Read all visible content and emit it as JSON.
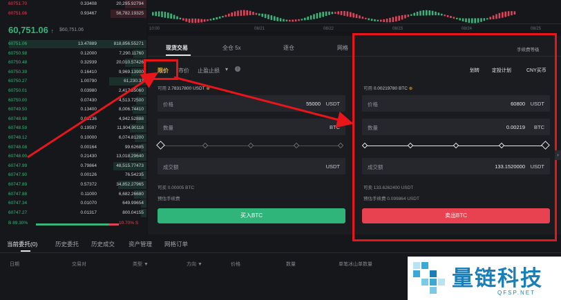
{
  "orderbook": {
    "asks": [
      {
        "price": "60751.70",
        "amount": "0.33408",
        "total": "20,295.92794"
      },
      {
        "price": "60751.06",
        "amount": "0.93467",
        "total": "56,782.19325"
      }
    ],
    "last_price": "60,751.06",
    "last_price_arrow": "↑",
    "last_price_sub": "$60,751.06",
    "bids": [
      {
        "price": "60751.06",
        "amount": "13.47889",
        "total": "818,856.55271"
      },
      {
        "price": "60750.98",
        "amount": "0.12000",
        "total": "7,290.11760"
      },
      {
        "price": "60750.48",
        "amount": "0.32939",
        "total": "20,010.57426"
      },
      {
        "price": "60750.39",
        "amount": "0.16410",
        "total": "9,969.13900"
      },
      {
        "price": "60750.27",
        "amount": "1.00790",
        "total": "61,230.33"
      },
      {
        "price": "60750.01",
        "amount": "0.03980",
        "total": "2,417.85060"
      },
      {
        "price": "60750.00",
        "amount": "0.07430",
        "total": "4,513.72500"
      },
      {
        "price": "60749.50",
        "amount": "0.13400",
        "total": "8,006.74410"
      },
      {
        "price": "60748.98",
        "amount": "0.08136",
        "total": "4,942.52888"
      },
      {
        "price": "60748.59",
        "amount": "0.19597",
        "total": "11,904.90118"
      },
      {
        "price": "60748.12",
        "amount": "0.10000",
        "total": "6,074.81200"
      },
      {
        "price": "60748.08",
        "amount": "0.00164",
        "total": "99.62685"
      },
      {
        "price": "60748.00",
        "amount": "0.21430",
        "total": "13,018.29640"
      },
      {
        "price": "60747.99",
        "amount": "0.79864",
        "total": "48,515.77473"
      },
      {
        "price": "60747.90",
        "amount": "0.00126",
        "total": "76.54235"
      },
      {
        "price": "60747.89",
        "amount": "0.57372",
        "total": "34,852.27965"
      },
      {
        "price": "60747.88",
        "amount": "0.11000",
        "total": "6,682.26680"
      },
      {
        "price": "60747.34",
        "amount": "0.01070",
        "total": "649.99654"
      },
      {
        "price": "60747.27",
        "amount": "0.01317",
        "total": "800.04155"
      }
    ],
    "buy_ratio": "89.30%",
    "sell_ratio": "10.70%",
    "sell_ratio_suffix": "S"
  },
  "chart": {
    "time_labels": [
      "10:00",
      "08/21",
      "08/22",
      "08/23",
      "08/24",
      "08/25"
    ]
  },
  "trade": {
    "tabs": [
      "现货交易",
      "全仓 5x",
      "逐仓",
      "网格"
    ],
    "fee_link": "手续费等级",
    "buy": {
      "order_types": [
        "限价",
        "市价",
        "止盈止损"
      ],
      "available_label": "可用",
      "available_value": "2.78317800 USDT",
      "price_label": "价格",
      "price_value": "55000",
      "price_unit": "USDT",
      "qty_label": "数量",
      "qty_value": "",
      "qty_unit": "BTC",
      "total_label": "成交额",
      "total_value": "",
      "total_unit": "USDT",
      "can_buy": "可买 0.00005 BTC",
      "fee": "预估手续费",
      "button": "买入BTC"
    },
    "sell": {
      "actions": [
        "划转",
        "定投计划",
        "CNY买币"
      ],
      "available_label": "可用",
      "available_value": "0.00219780 BTC",
      "price_label": "价格",
      "price_value": "60800",
      "price_unit": "USDT",
      "qty_label": "数量",
      "qty_value": "0.00219",
      "qty_unit": "BTC",
      "total_label": "成交额",
      "total_value": "133.1520000",
      "total_unit": "USDT",
      "can_sell": "可卖 133.6262400 USDT",
      "fee": "预估手续费 0.099864 USDT",
      "button": "卖出BTC"
    }
  },
  "orders": {
    "tabs": [
      "当前委托(0)",
      "历史委托",
      "历史成交",
      "资产管理",
      "网格订单"
    ],
    "columns": [
      "日期",
      "交易对",
      "类型 ▼",
      "方向 ▼",
      "价格",
      "数量",
      "单笔冰山单数量"
    ]
  },
  "watermark": {
    "brand": "量链科技",
    "domain": "QFSP.NET"
  },
  "colors": {
    "red": "#e8161b",
    "green": "#3bb37a",
    "sell_button": "#e8414f",
    "buy_button": "#2fb47a"
  }
}
